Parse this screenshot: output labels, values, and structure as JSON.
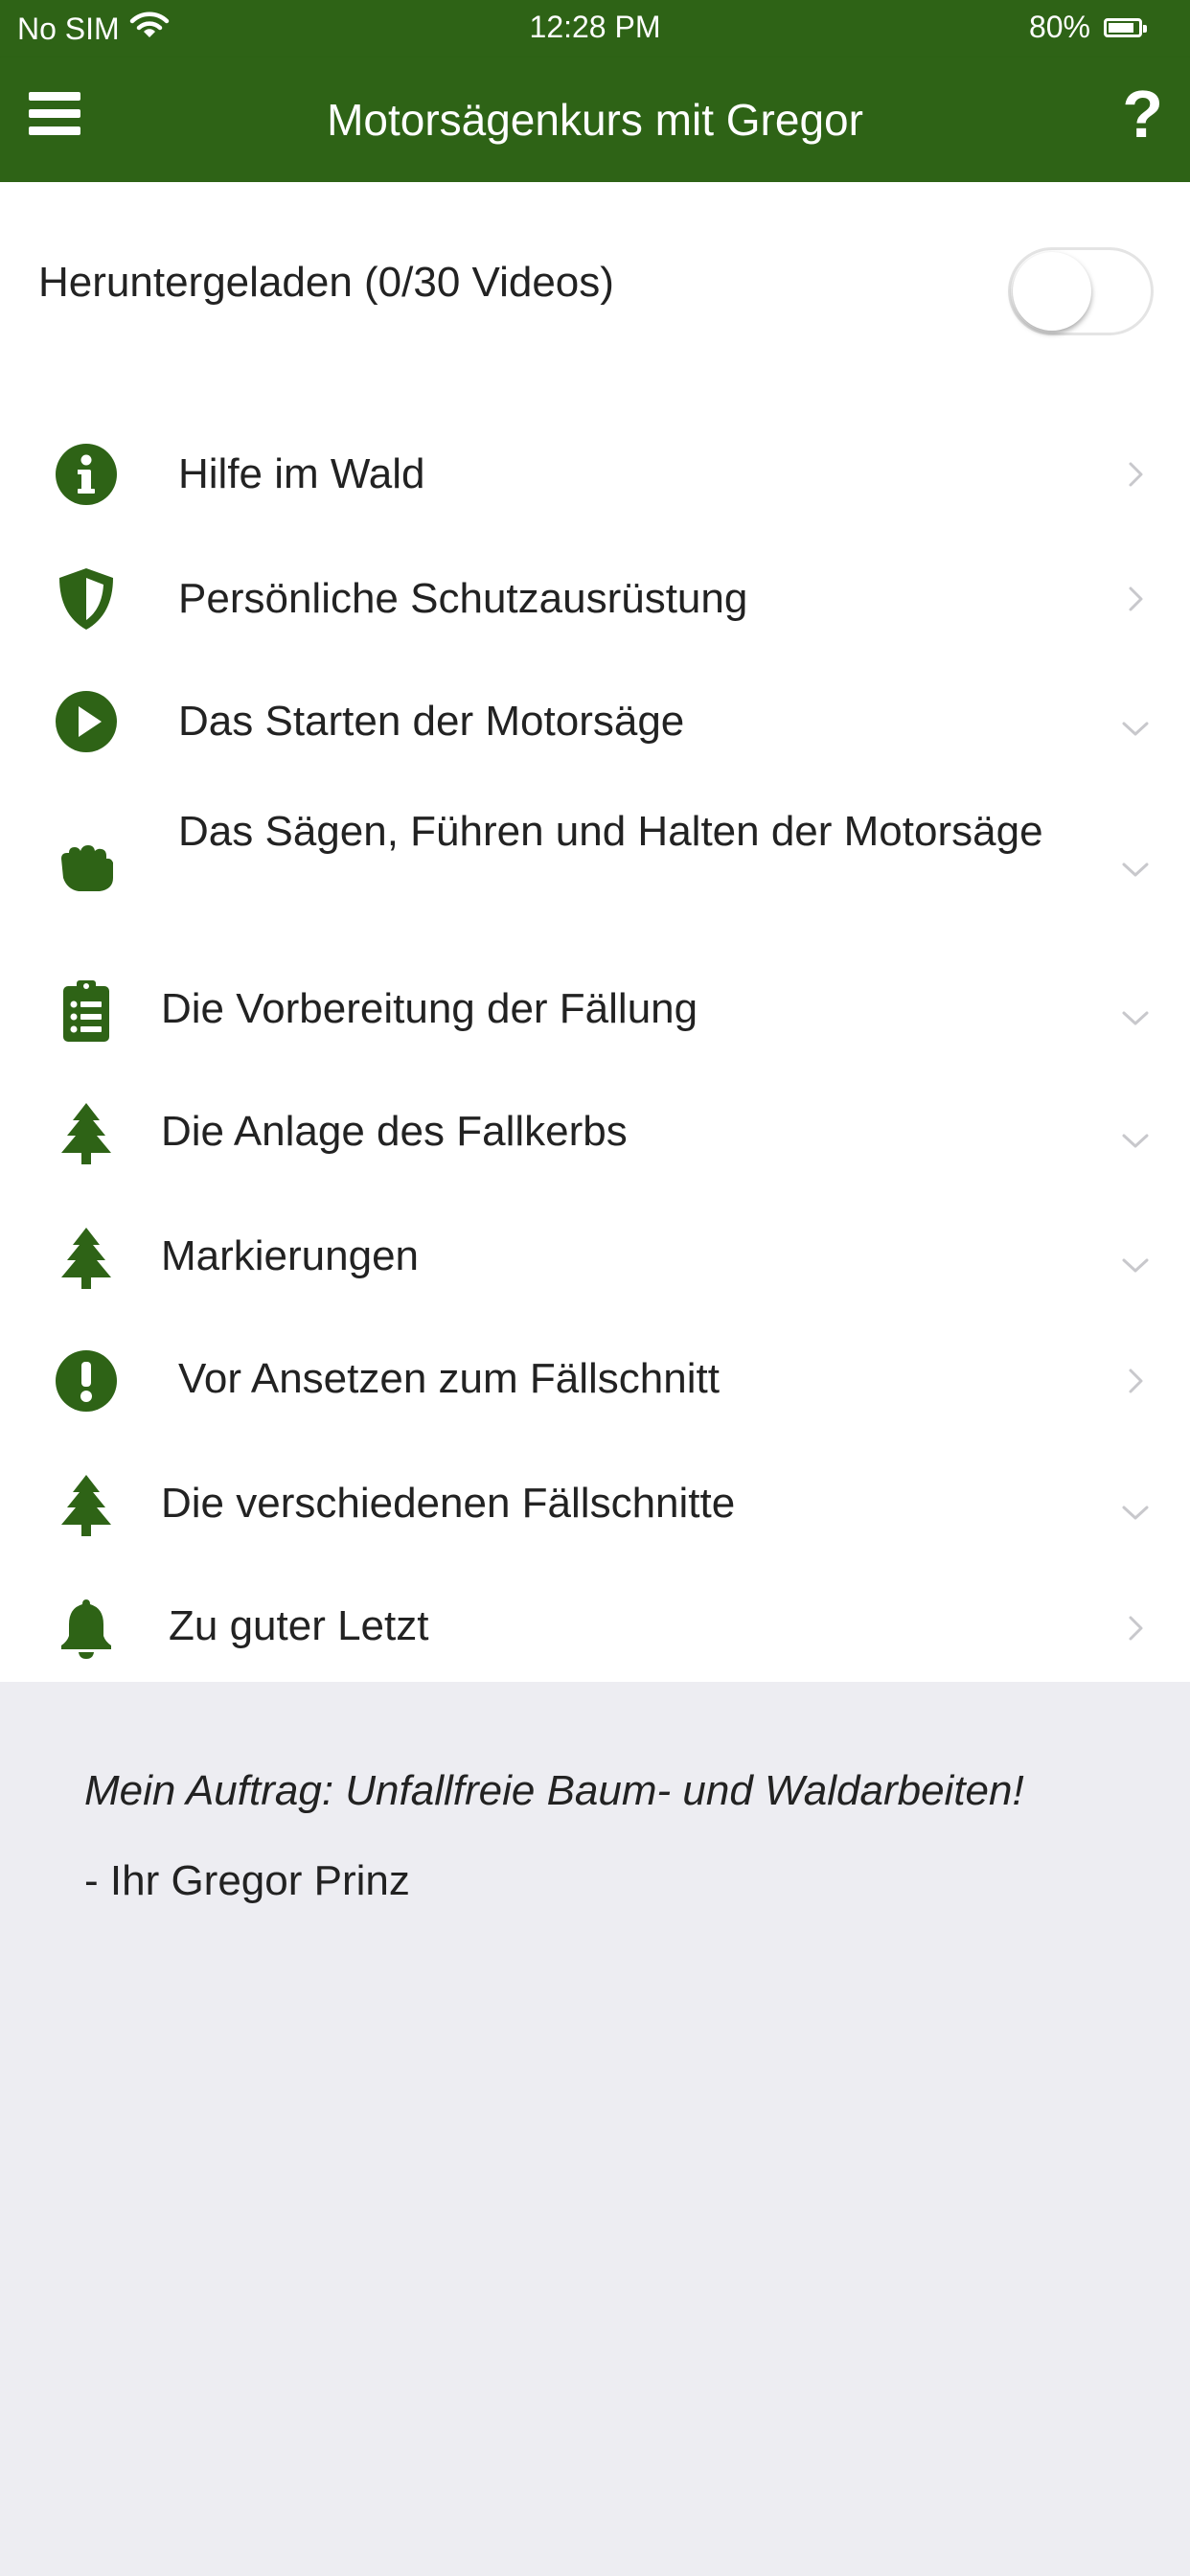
{
  "status_bar": {
    "carrier": "No SIM",
    "time": "12:28 PM",
    "battery": "80%",
    "battery_level": 0.8
  },
  "header": {
    "title": "Motorsägenkurs mit Gregor",
    "help_label": "?"
  },
  "downloads": {
    "label": "Heruntergeladen (0/30 Videos)",
    "enabled": false
  },
  "menu": [
    {
      "label": "Hilfe im Wald",
      "icon": "info-circle-icon",
      "chevron": "right"
    },
    {
      "label": "Persönliche Schutzausrüstung",
      "icon": "shield-icon",
      "chevron": "right"
    },
    {
      "label": "Das Starten der Motorsäge",
      "icon": "play-circle-icon",
      "chevron": "down"
    },
    {
      "label": "Das Sägen, Führen und Halten der Motorsäge",
      "icon": "hand-icon",
      "chevron": "down"
    },
    {
      "label": "Die Vorbereitung der Fällung",
      "icon": "clipboard-list-icon",
      "chevron": "down"
    },
    {
      "label": "Die Anlage des Fallkerbs",
      "icon": "tree-icon",
      "chevron": "down"
    },
    {
      "label": "Markierungen",
      "icon": "tree-icon",
      "chevron": "down"
    },
    {
      "label": "Vor Ansetzen zum Fällschnitt",
      "icon": "exclamation-circle-icon",
      "chevron": "right"
    },
    {
      "label": "Die verschiedenen Fällschnitte",
      "icon": "tree-icon",
      "chevron": "down"
    },
    {
      "label": "Zu guter Letzt",
      "icon": "bell-icon",
      "chevron": "right"
    }
  ],
  "footer": {
    "quote": "Mein Auftrag: Unfallfreie Baum- und Waldarbeiten!",
    "signature": "- Ihr Gregor Prinz"
  },
  "colors": {
    "brand_green": "#2e6316",
    "content_bg": "#ffffff",
    "page_bg": "#ededf2",
    "chevron": "#c8c8cc"
  }
}
